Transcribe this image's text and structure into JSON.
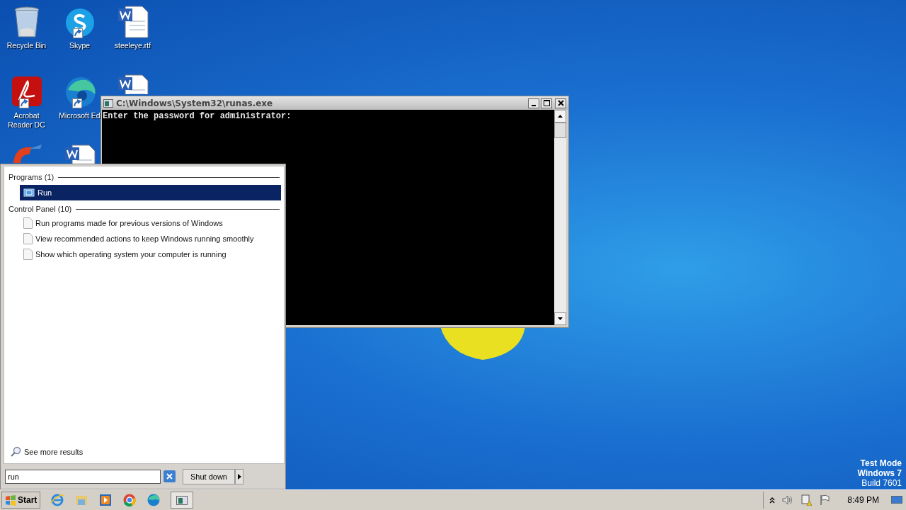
{
  "desktop_icons": [
    {
      "label": "Recycle Bin",
      "kind": "recycle",
      "shortcut": false
    },
    {
      "label": "Skype",
      "kind": "skype",
      "shortcut": true
    },
    {
      "label": "steeleye.rtf",
      "kind": "word",
      "shortcut": false
    },
    {
      "label": "Acrobat Reader DC",
      "kind": "acrobat",
      "shortcut": true
    },
    {
      "label": "Microsoft Ed",
      "kind": "edge",
      "shortcut": true
    },
    {
      "kind": "word",
      "shortcut": false
    },
    {
      "kind": "ccleaner",
      "shortcut": false
    },
    {
      "kind": "word",
      "shortcut": false
    }
  ],
  "console": {
    "title": "C:\\Windows\\System32\\runas.exe",
    "lines": [
      "Enter the password for administrator:"
    ]
  },
  "start_menu": {
    "groups": [
      {
        "heading": "Programs (1)",
        "items": [
          {
            "label": "Run",
            "kind": "run",
            "selected": true
          }
        ]
      },
      {
        "heading": "Control Panel (10)",
        "items": [
          {
            "label": "Run programs made for previous versions of Windows",
            "kind": "page",
            "selected": false
          },
          {
            "label": "View recommended actions to keep Windows running smoothly",
            "kind": "page",
            "selected": false
          },
          {
            "label": "Show which operating system your computer is running",
            "kind": "page",
            "selected": false
          }
        ]
      }
    ],
    "see_more": "See more results",
    "search": {
      "value": "run"
    },
    "shutdown": "Shut down"
  },
  "desktop_notice": [
    "Test Mode",
    "Windows 7",
    "Build 7601"
  ],
  "taskbar": {
    "start": "Start",
    "apps": [
      {
        "kind": "ie"
      },
      {
        "kind": "explorer"
      },
      {
        "kind": "media"
      },
      {
        "kind": "chrome"
      },
      {
        "kind": "edge"
      },
      {
        "kind": "console"
      }
    ],
    "clock": "8:49 PM"
  }
}
